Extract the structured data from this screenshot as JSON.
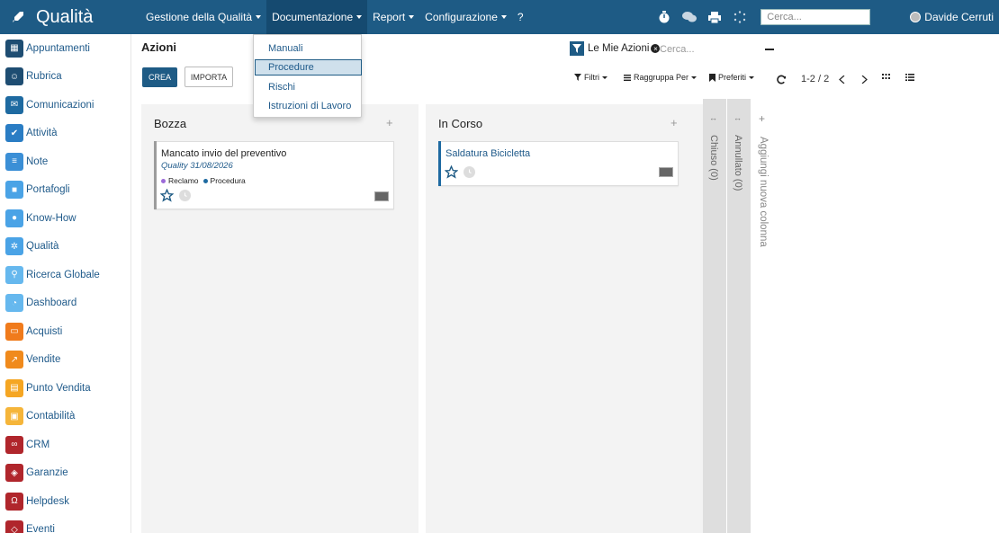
{
  "app": {
    "title": "Qualità"
  },
  "mainmenu": [
    {
      "label": "Gestione della Qualità",
      "caret": true
    },
    {
      "label": "Documentazione",
      "caret": true,
      "active": true
    },
    {
      "label": "Report",
      "caret": true
    },
    {
      "label": "Configurazione",
      "caret": true
    },
    {
      "label": "?",
      "caret": false
    }
  ],
  "topbar": {
    "search_placeholder": "Cerca...",
    "user_name": "Davide Cerruti"
  },
  "sidebar": {
    "items": [
      {
        "label": "Appuntamenti",
        "color": "#1e4d72",
        "icon": "calendar-icon"
      },
      {
        "label": "Rubrica",
        "color": "#1e4d72",
        "icon": "contacts-icon"
      },
      {
        "label": "Comunicazioni",
        "color": "#1e6aa1",
        "icon": "chat-icon"
      },
      {
        "label": "Attività",
        "color": "#2a7dc4",
        "icon": "check-icon"
      },
      {
        "label": "Note",
        "color": "#3b8fd6",
        "icon": "note-icon"
      },
      {
        "label": "Portafogli",
        "color": "#4aa3e6",
        "icon": "lock-icon"
      },
      {
        "label": "Know-How",
        "color": "#4aa3e6",
        "icon": "lightbulb-icon"
      },
      {
        "label": "Qualità",
        "color": "#4aa3e6",
        "icon": "quality-icon"
      },
      {
        "label": "Ricerca Globale",
        "color": "#66b8ee",
        "icon": "search-icon"
      },
      {
        "label": "Dashboard",
        "color": "#66b8ee",
        "icon": "dashboard-icon"
      },
      {
        "label": "Acquisti",
        "color": "#f07b1c",
        "icon": "cart-icon"
      },
      {
        "label": "Vendite",
        "color": "#f08a1c",
        "icon": "chart-icon"
      },
      {
        "label": "Punto Vendita",
        "color": "#f5a623",
        "icon": "pos-icon"
      },
      {
        "label": "Contabilità",
        "color": "#f5b53a",
        "icon": "accounting-icon"
      },
      {
        "label": "CRM",
        "color": "#b0262c",
        "icon": "handshake-icon"
      },
      {
        "label": "Garanzie",
        "color": "#b0262c",
        "icon": "shield-icon"
      },
      {
        "label": "Helpdesk",
        "color": "#b0262c",
        "icon": "headset-icon"
      },
      {
        "label": "Eventi",
        "color": "#b0262c",
        "icon": "ticket-icon"
      }
    ]
  },
  "control_panel": {
    "title": "Azioni",
    "create_label": "CREA",
    "import_label": "IMPORTA",
    "facet_label": "Le Mie Azioni",
    "search_placeholder": "Cerca...",
    "filters_label": "Filtri",
    "groupby_label": "Raggruppa Per",
    "favorites_label": "Preferiti",
    "pager": "1-2 / 2"
  },
  "dropdown": {
    "items": [
      {
        "label": "Manuali"
      },
      {
        "label": "Procedure",
        "hover": true
      },
      {
        "label": "Rischi"
      },
      {
        "label": "Istruzioni di Lavoro"
      }
    ]
  },
  "kanban": {
    "columns": [
      {
        "title": "Bozza",
        "cards": [
          {
            "title": "Mancato invio del preventivo",
            "subtitle": "Quality 31/08/2026",
            "tags": [
              {
                "label": "Reclamo",
                "color": "#9c6ad8"
              },
              {
                "label": "Procedura",
                "color": "#1e6aa1"
              }
            ],
            "bar_color": "#9c9c9c"
          }
        ]
      },
      {
        "title": "In Corso",
        "cards": [
          {
            "title": "Saldatura Bicicletta",
            "bar_color": "#1e6aa1"
          }
        ]
      }
    ],
    "folded": [
      {
        "label": "Chiuso (0)"
      },
      {
        "label": "Annullato (0)"
      }
    ],
    "add_column_label": "Aggiungi nuova colonna"
  }
}
